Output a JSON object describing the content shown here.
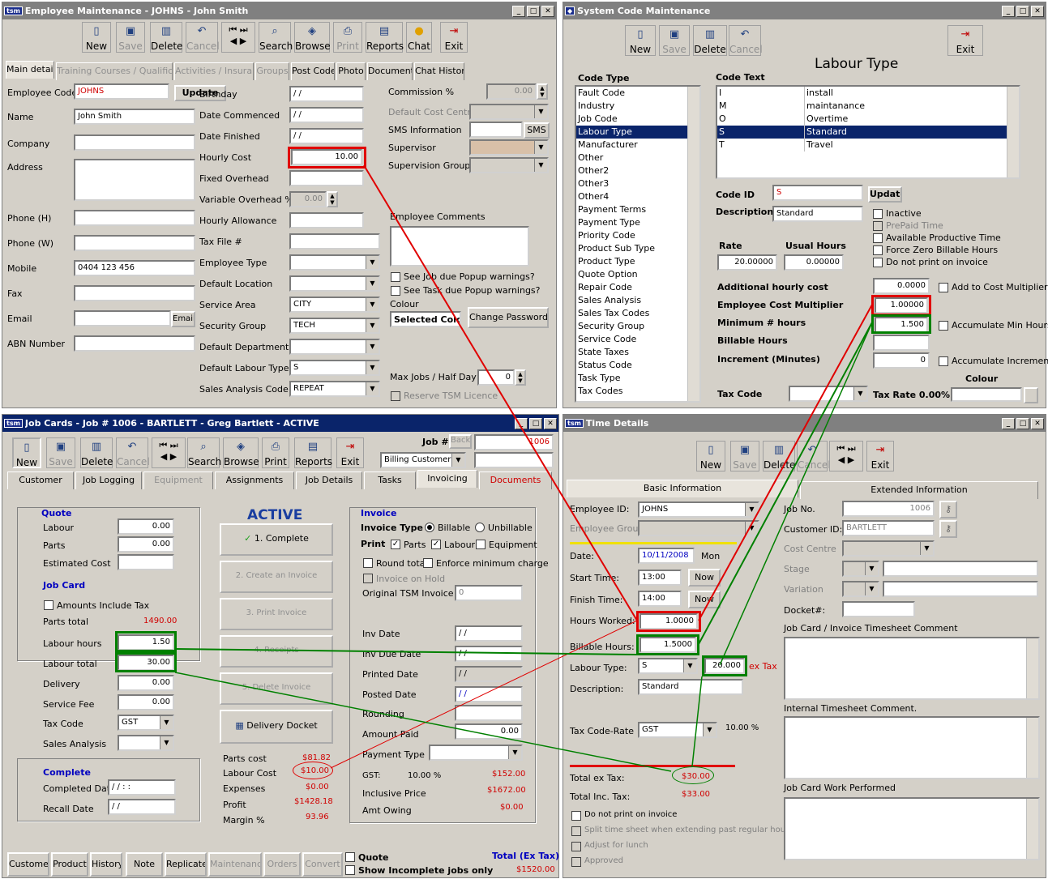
{
  "emp": {
    "title": "Employee Maintenance - JOHNS - John Smith",
    "logo": "tsm",
    "toolbar": [
      "New",
      "Save",
      "Delete",
      "Cancel",
      "",
      "",
      "Search",
      "Browse",
      "Print",
      "Reports",
      "Chat",
      "Exit"
    ],
    "tabs": [
      "Main details",
      "Training Courses / Qualifications",
      "Activities / Insurance",
      "Groups",
      "Post Code",
      "Photo",
      "Documents",
      "Chat History"
    ],
    "labels": {
      "code": "Employee Code",
      "name": "Name",
      "company": "Company",
      "address": "Address",
      "ph": "Phone (H)",
      "pw": "Phone (W)",
      "mobile": "Mobile",
      "fax": "Fax",
      "email": "Email",
      "abn": "ABN Number",
      "birthday": "Birthday",
      "commenced": "Date Commenced",
      "finished": "Date Finished",
      "hourly": "Hourly Cost",
      "fixed": "Fixed Overhead",
      "variable": "Variable Overhead %",
      "allow": "Hourly Allowance",
      "taxfile": "Tax File #",
      "etype": "Employee Type",
      "loc": "Default Location",
      "area": "Service Area",
      "secg": "Security Group",
      "dept": "Default Department",
      "labtype": "Default Labour Type",
      "sales": "Sales Analysis Code",
      "comm": "Commission %",
      "dcc": "Default Cost Centre",
      "sms": "SMS Information",
      "sup": "Supervisor",
      "supg": "Supervision Group",
      "comments": "Employee Comments",
      "seejob": "See Job due Popup warnings?",
      "seetask": "See Task due Popup warnings?",
      "colour": "Colour",
      "maxjobs": "Max Jobs / Half Day",
      "reserve": "Reserve TSM Licence"
    },
    "values": {
      "code": "JOHNS",
      "name": "John Smith",
      "mobile": "0404 123 456",
      "birthday": "/ /",
      "commenced": "/ /",
      "finished": "/ /",
      "hourly": "10.00",
      "variable": "0.00",
      "area": "CITY",
      "secg": "TECH",
      "labtype": "S",
      "sales": "REPEAT",
      "comm": "0.00",
      "maxjobs": "0"
    },
    "buttons": {
      "update": "Update",
      "sms": "SMS",
      "email": "Email",
      "colour": "Selected Colour",
      "password": "Change Password"
    }
  },
  "sys": {
    "title": "System Code Maintenance",
    "toolbar": [
      "New",
      "Save",
      "Delete",
      "Cancel",
      "Exit"
    ],
    "heading": "Labour Type",
    "code_type_label": "Code Type",
    "code_text_label": "Code Text",
    "code_types": [
      "Fault Code",
      "Industry",
      "Job Code",
      "Labour Type",
      "Manufacturer",
      "Other",
      "Other2",
      "Other3",
      "Other4",
      "Payment Terms",
      "Payment Type",
      "Priority Code",
      "Product Sub Type",
      "Product Type",
      "Quote Option",
      "Repair Code",
      "Sales Analysis",
      "Sales Tax Codes",
      "Security Group",
      "Service Code",
      "State Taxes",
      "Status Code",
      "Task Type",
      "Tax Codes"
    ],
    "codes": [
      {
        "id": "I",
        "text": "install"
      },
      {
        "id": "M",
        "text": "maintanance"
      },
      {
        "id": "O",
        "text": "Overtime"
      },
      {
        "id": "S",
        "text": "Standard"
      },
      {
        "id": "T",
        "text": "Travel"
      }
    ],
    "labels": {
      "cid": "Code ID",
      "desc": "Description",
      "rate": "Rate",
      "usual": "Usual Hours",
      "addl": "Additional hourly cost",
      "mult": "Employee Cost Multiplier",
      "minh": "Minimum # hours",
      "bill": "Billable Hours",
      "incr": "Increment (Minutes)",
      "taxcode": "Tax Code",
      "taxrate": "Tax Rate 0.00%",
      "colour": "Colour",
      "inactive": "Inactive",
      "prepaid": "PrePaid Time",
      "avail": "Available Productive Time",
      "force": "Force Zero Billable Hours",
      "donot": "Do not print on invoice",
      "addcost": "Add to Cost Multiplier",
      "accmin": "Accumulate Min Hours",
      "accinc": "Accumulate Increment"
    },
    "values": {
      "cid": "S",
      "desc": "Standard",
      "rate": "20.00000",
      "usual": "0.00000",
      "addl": "0.0000",
      "mult": "1.00000",
      "minh": "1.500",
      "incr": "0",
      "update": "Update"
    }
  },
  "job": {
    "title": "Job Cards - Job # 1006 - BARTLETT - Greg Bartlett - ACTIVE",
    "toolbar": [
      "New",
      "Save",
      "Delete",
      "Cancel",
      "",
      "",
      "Search",
      "Browse",
      "Print",
      "Reports",
      "Exit"
    ],
    "jobno_label": "Job #",
    "back": "Back",
    "jobno": "1006",
    "billing": "Billing Customer #",
    "tabs": [
      "Customer",
      "Job Logging",
      "Equipment",
      "Assignments",
      "Job Details",
      "Tasks",
      "Invoicing",
      "Documents"
    ],
    "quote": {
      "h": "Quote",
      "labour": "Labour",
      "parts": "Parts",
      "est": "Estimated Cost",
      "labour_v": "0.00",
      "parts_v": "0.00"
    },
    "card": {
      "h": "Job Card",
      "amounts": "Amounts Include Tax",
      "parts_total": "Parts total",
      "parts_total_v": "1490.00",
      "lhours": "Labour hours",
      "lhours_v": "1.50",
      "ltotal": "Labour total",
      "ltotal_v": "30.00",
      "delivery": "Delivery",
      "delivery_v": "0.00",
      "fee": "Service Fee",
      "fee_v": "0.00",
      "tax": "Tax Code",
      "tax_v": "GST",
      "sales": "Sales Analysis"
    },
    "complete": {
      "h": "Complete",
      "date": "Completed Date",
      "date_v": "/ /  : :",
      "recall": "Recall Date",
      "recall_v": "/ /"
    },
    "status": "ACTIVE",
    "actions": [
      "1. Complete",
      "2. Create an Invoice",
      "3. Print Invoice",
      "4. Receipts",
      "5. Delete Invoice",
      "Delivery Docket"
    ],
    "costs": {
      "parts": "Parts cost",
      "parts_v": "$81.82",
      "labour": "Labour Cost",
      "labour_v": "$10.00",
      "exp": "Expenses",
      "exp_v": "$0.00",
      "profit": "Profit",
      "profit_v": "$1428.18",
      "margin": "Margin %",
      "margin_v": "93.96"
    },
    "inv": {
      "h": "Invoice",
      "type": "Invoice Type",
      "billable": "Billable",
      "unbill": "Unbillable",
      "print": "Print",
      "parts": "Parts",
      "labour": "Labour",
      "equip": "Equipment",
      "round": "Round total",
      "enforce": "Enforce minimum charge",
      "hold": "Invoice on Hold",
      "orig": "Original TSM Invoice #",
      "orig_v": "0",
      "invdate": "Inv Date",
      "due": "Inv Due Date",
      "printed": "Printed Date",
      "posted": "Posted Date",
      "rounding": "Rounding",
      "paid": "Amount Paid",
      "paid_v": "0.00",
      "ptype": "Payment Type",
      "gst": "GST:",
      "gst_pct": "10.00 %",
      "gst_v": "$152.00",
      "incl": "Inclusive Price",
      "incl_v": "$1672.00",
      "owing": "Amt Owing",
      "owing_v": "$0.00",
      "date_v": "/ /"
    },
    "bottom": [
      "Customer",
      "Product",
      "History",
      "Note",
      "Replicate",
      "Maintenance",
      "Orders",
      "Convert"
    ],
    "quote_chk": "Quote",
    "incomplete": "Show Incomplete jobs only",
    "total_label": "Total (Ex Tax)",
    "total_v": "$1520.00"
  },
  "time": {
    "title": "Time Details",
    "logo": "tsm",
    "toolbar": [
      "New",
      "Save",
      "Delete",
      "Cancel",
      "",
      "",
      "Exit"
    ],
    "tabs": [
      "Basic Information",
      "Extended Information"
    ],
    "labels": {
      "emp": "Employee ID:",
      "grp": "Employee Group",
      "date": "Date:",
      "start": "Start Time:",
      "finish": "Finish Time:",
      "worked": "Hours Worked:",
      "billable": "Billable Hours:",
      "ltype": "Labour Type:",
      "desc": "Description:",
      "tax": "Tax Code-Rate",
      "exTax": "Total ex Tax:",
      "incTax": "Total Inc. Tax:",
      "donot": "Do not print on invoice",
      "split": "Split time sheet when extending past regular hours.",
      "lunch": "Adjust for lunch",
      "approved": "Approved",
      "jobno": "Job No.",
      "cust": "Customer ID:",
      "cc": "Cost Centre",
      "stage": "Stage",
      "variation": "Variation",
      "docket": "Docket#:",
      "jcomment": "Job Card / Invoice Timesheet Comment",
      "internal": "Internal Timesheet Comment.",
      "performed": "Job Card Work Performed",
      "extax": "ex Tax"
    },
    "values": {
      "emp": "JOHNS",
      "date": "10/11/2008",
      "day": "Mon",
      "start": "13:00",
      "finish": "14:00",
      "now": "Now",
      "worked": "1.0000",
      "billable": "1.5000",
      "ltype": "S",
      "rate": "20.000",
      "desc": "Standard",
      "tax": "GST",
      "taxpct": "10.00 %",
      "exTax": "$30.00",
      "incTax": "$33.00",
      "jobno": "1006",
      "cust": "BARTLETT"
    }
  }
}
